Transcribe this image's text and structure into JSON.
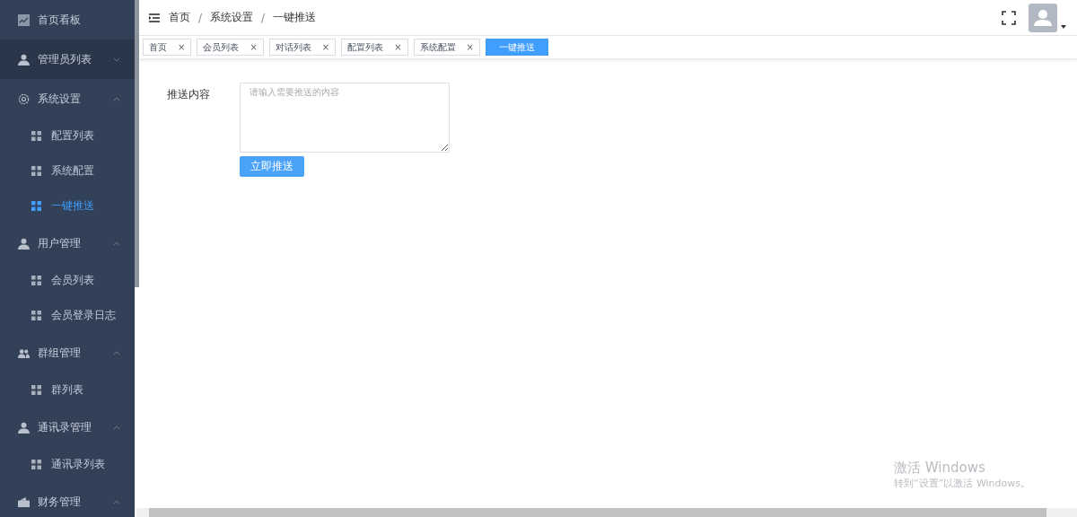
{
  "sidebar": {
    "items": [
      {
        "label": "首页看板",
        "kind": "dashboard",
        "hovered": false
      },
      {
        "label": "管理员列表",
        "kind": "user",
        "hovered": true,
        "expanded": false
      },
      {
        "label": "系统设置",
        "kind": "settings",
        "hovered": false,
        "expanded": true,
        "children": [
          {
            "label": "配置列表",
            "selected": false
          },
          {
            "label": "系统配置",
            "selected": false
          },
          {
            "label": "一键推送",
            "selected": true
          }
        ]
      },
      {
        "label": "用户管理",
        "kind": "user",
        "hovered": false,
        "expanded": true,
        "children": [
          {
            "label": "会员列表",
            "selected": false
          },
          {
            "label": "会员登录日志",
            "selected": false
          }
        ]
      },
      {
        "label": "群组管理",
        "kind": "group",
        "hovered": false,
        "expanded": true,
        "children": [
          {
            "label": "群列表",
            "selected": false
          }
        ]
      },
      {
        "label": "通讯录管理",
        "kind": "user",
        "hovered": false,
        "expanded": true,
        "children": [
          {
            "label": "通讯录列表",
            "selected": false
          }
        ]
      },
      {
        "label": "财务管理",
        "kind": "wallet",
        "hovered": false,
        "expanded": true
      }
    ]
  },
  "breadcrumb": [
    {
      "label": "首页"
    },
    {
      "separator": "/",
      "label": "系统设置"
    },
    {
      "separator": "/",
      "label": "一键推送"
    }
  ],
  "tags": [
    {
      "label": "首页",
      "close": "×",
      "selected": false
    },
    {
      "label": "会员列表",
      "close": "×",
      "selected": false
    },
    {
      "label": "对话列表",
      "close": "×",
      "selected": false
    },
    {
      "label": "配置列表",
      "close": "×",
      "selected": false
    },
    {
      "label": "系统配置",
      "close": "×",
      "selected": false
    },
    {
      "label": "一键推送",
      "selected": true
    }
  ],
  "form": {
    "label": "推送内容",
    "placeholder": "请输入需要推送的内容",
    "button": "立即推送"
  },
  "windows_activation": {
    "title": "激活 Windows",
    "subtitle": "转到“设置”以激活 Windows。"
  }
}
